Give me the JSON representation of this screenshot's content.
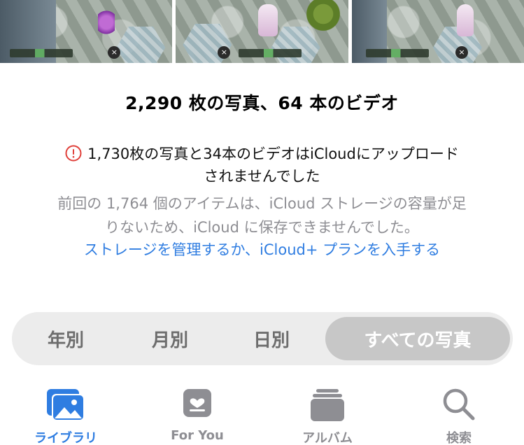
{
  "thumbnails": [
    {
      "hud_button": "×"
    },
    {
      "hud_button": "×"
    },
    {
      "hud_button": "×"
    }
  ],
  "library": {
    "count_title": "2,290 枚の写真、64 本のビデオ",
    "warning_line1": "1,730枚の写真と34本のビデオはiCloudにアップロード",
    "warning_line2": "されませんでした",
    "info_line1": "前回の 1,764 個のアイテムは、iCloud ストレージの容量が足",
    "info_line2": "りないため、iCloud に保存できませんでした。",
    "link_text": "ストレージを管理するか、iCloud+ プランを入手する"
  },
  "segments": [
    {
      "label": "年別",
      "selected": false
    },
    {
      "label": "月別",
      "selected": false
    },
    {
      "label": "日別",
      "selected": false
    },
    {
      "label": "すべての写真",
      "selected": true
    }
  ],
  "tabs": [
    {
      "label": "ライブラリ",
      "icon": "photos-library-icon",
      "active": true
    },
    {
      "label": "For You",
      "icon": "for-you-icon",
      "active": false
    },
    {
      "label": "アルバム",
      "icon": "albums-icon",
      "active": false
    },
    {
      "label": "検索",
      "icon": "search-icon",
      "active": false
    }
  ],
  "colors": {
    "accent": "#2f7de1",
    "warning": "#e0403a",
    "secondary_text": "#8e8e93",
    "segment_bg": "#ececec",
    "segment_selected": "#c7c7c7"
  }
}
